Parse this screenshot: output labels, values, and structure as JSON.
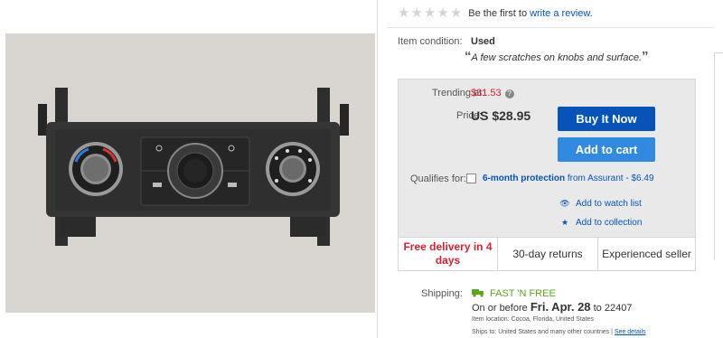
{
  "rating": {
    "stars": 0,
    "prompt": "Be the first to",
    "link": "write a review."
  },
  "condition": {
    "label": "Item condition:",
    "value": "Used",
    "note": "A few scratches on knobs and surface.",
    "open_quote": "“",
    "close_quote": "”"
  },
  "pricing": {
    "trending_label": "Trending at:",
    "trending_value": "$31.53",
    "help_icon": "?",
    "price_label": "Price:",
    "price_value": "US $28.95",
    "buy_now": "Buy It Now",
    "add_to_cart": "Add to cart"
  },
  "protection": {
    "label": "Qualifies for:",
    "plan": "6-month protection",
    "from": "from Assurant",
    "price": "- $6.49"
  },
  "actions": {
    "watch": "Add to watch list",
    "collection": "Add to collection"
  },
  "features": {
    "delivery": "Free delivery in 4 days",
    "returns": "30-day returns",
    "seller": "Experienced seller"
  },
  "shipping": {
    "label": "Shipping:",
    "service": "FAST 'N FREE",
    "on_or_before": "On or before",
    "date": "Fri. Apr. 28",
    "to": "to 22407",
    "location_label": "Item location:",
    "location": "Cocoa, Florida, United States",
    "ships_to_label": "Ships to:",
    "ships_to": "United States and many other countries |",
    "see_details": "See details"
  },
  "colors": {
    "link": "#0654ba",
    "buy_button": "#0654ba",
    "cart_button": "#2f8ae0",
    "alert_red": "#dd1e31",
    "fast_green": "#5ba71b"
  }
}
